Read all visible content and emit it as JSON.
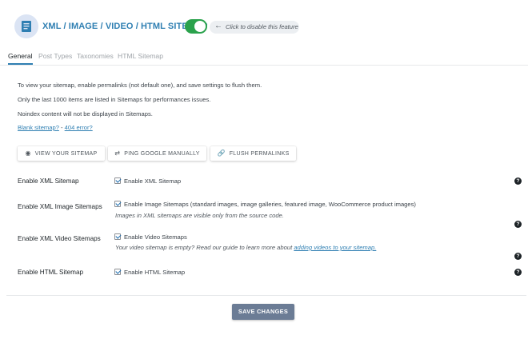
{
  "header": {
    "title": "XML / IMAGE / VIDEO / HTML SITEMAP",
    "logo_icon": "sitemap-document-icon",
    "toggle_on": true,
    "toggle_color": "#2aa24c",
    "hint_text": "Click to disable this feature"
  },
  "tabs": [
    {
      "label": "General",
      "active": true
    },
    {
      "label": "Post Types",
      "active": false
    },
    {
      "label": "Taxonomies",
      "active": false
    },
    {
      "label": "HTML Sitemap",
      "active": false
    }
  ],
  "info": {
    "line1": "To view your sitemap, enable permalinks (not default one), and save settings to flush them.",
    "line2": "Only the last 1000 items are listed in Sitemaps for performances issues.",
    "line3": "Noindex content will not be displayed in Sitemaps.",
    "link_blank": "Blank sitemap?",
    "link_sep": " - ",
    "link_404": "404 error?"
  },
  "actions": {
    "view": "VIEW YOUR SITEMAP",
    "ping": "PING GOOGLE MANUALLY",
    "flush": "FLUSH PERMALINKS"
  },
  "settings": {
    "xml": {
      "label": "Enable XML Sitemap",
      "checkbox": "Enable XML Sitemap",
      "checked": true
    },
    "image": {
      "label": "Enable XML Image Sitemaps",
      "checkbox": "Enable Image Sitemaps (standard images, image galleries, featured image, WooCommerce product images)",
      "checked": true,
      "description": "Images in XML sitemaps are visible only from the source code."
    },
    "video": {
      "label": "Enable XML Video Sitemaps",
      "checkbox": "Enable Video Sitemaps",
      "checked": true,
      "description": "Your video sitemap is empty? Read our guide to learn more about ",
      "description_link": "adding videos to your sitemap."
    },
    "html": {
      "label": "Enable HTML Sitemap",
      "checkbox": "Enable HTML Sitemap",
      "checked": true
    }
  },
  "footer": {
    "save_label": "SAVE CHANGES",
    "save_color": "#6b7c95"
  },
  "colors": {
    "accent": "#2f7fb2"
  }
}
